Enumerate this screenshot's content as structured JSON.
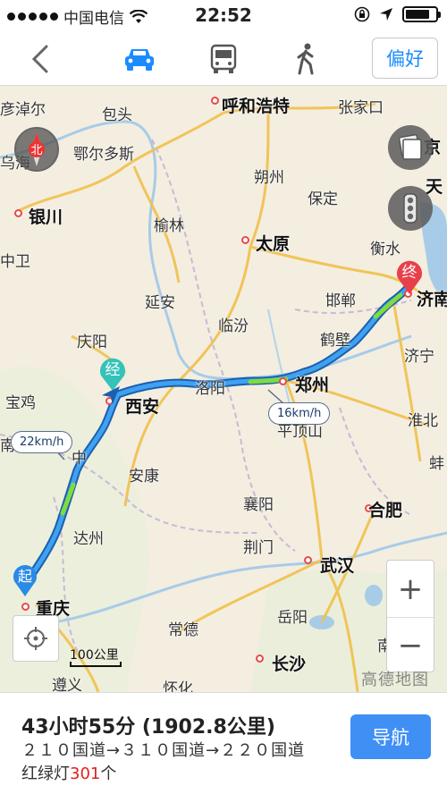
{
  "status_bar": {
    "carrier": "中国电信",
    "time": "22:52",
    "battery_level": 0.8,
    "icons": [
      "signal-dots-icon",
      "wifi-icon",
      "rotation-lock-icon",
      "location-arrow-icon",
      "battery-icon"
    ]
  },
  "nav": {
    "back_icon": "chevron-left-icon",
    "modes": [
      {
        "name": "car-icon",
        "active": true
      },
      {
        "name": "bus-icon",
        "active": false
      },
      {
        "name": "walk-icon",
        "active": false
      }
    ],
    "preference_label": "偏好"
  },
  "map": {
    "cities": [
      {
        "id": "yandanger",
        "label": "彦淖尔",
        "major": false
      },
      {
        "id": "baotou",
        "label": "包头",
        "major": false
      },
      {
        "id": "huhehaote",
        "label": "呼和浩特",
        "major": true
      },
      {
        "id": "zhangjiakou",
        "label": "张家口",
        "major": false
      },
      {
        "id": "wuhai",
        "label": "乌海",
        "major": false
      },
      {
        "id": "eerduosi",
        "label": "鄂尔多斯",
        "major": false
      },
      {
        "id": "shuozhou",
        "label": "朔州",
        "major": false
      },
      {
        "id": "baoding",
        "label": "保定",
        "major": false
      },
      {
        "id": "tian",
        "label": "天",
        "major": false
      },
      {
        "id": "jing",
        "label": "京",
        "major": false
      },
      {
        "id": "yinchuan",
        "label": "银川",
        "major": true
      },
      {
        "id": "yulin",
        "label": "榆林",
        "major": false
      },
      {
        "id": "taiyuan",
        "label": "太原",
        "major": true
      },
      {
        "id": "hengshui",
        "label": "衡水",
        "major": false
      },
      {
        "id": "zhongwei",
        "label": "中卫",
        "major": false
      },
      {
        "id": "yanan",
        "label": "延安",
        "major": false
      },
      {
        "id": "handan",
        "label": "邯郸",
        "major": false
      },
      {
        "id": "jinan",
        "label": "济南",
        "major": true
      },
      {
        "id": "qingyang",
        "label": "庆阳",
        "major": false
      },
      {
        "id": "linfen",
        "label": "临汾",
        "major": false
      },
      {
        "id": "hebi",
        "label": "鹤壁",
        "major": false
      },
      {
        "id": "jining",
        "label": "济宁",
        "major": false
      },
      {
        "id": "baoji",
        "label": "宝鸡",
        "major": false
      },
      {
        "id": "xian",
        "label": "西安",
        "major": true
      },
      {
        "id": "luoyang",
        "label": "洛阳",
        "major": false
      },
      {
        "id": "zhengzhou",
        "label": "郑州",
        "major": true
      },
      {
        "id": "huaibei",
        "label": "淮北",
        "major": false
      },
      {
        "id": "nan",
        "label": "南",
        "major": false
      },
      {
        "id": "zhong",
        "label": "中",
        "major": false
      },
      {
        "id": "ankang",
        "label": "安康",
        "major": false
      },
      {
        "id": "pingdingshan",
        "label": "平顶山",
        "major": false
      },
      {
        "id": "bang",
        "label": "蚌",
        "major": false
      },
      {
        "id": "xiangyang",
        "label": "襄阳",
        "major": false
      },
      {
        "id": "hefei",
        "label": "合肥",
        "major": true
      },
      {
        "id": "dazhou",
        "label": "达州",
        "major": false
      },
      {
        "id": "jingmen",
        "label": "荆门",
        "major": false
      },
      {
        "id": "wuhan",
        "label": "武汉",
        "major": true
      },
      {
        "id": "chongqing",
        "label": "重庆",
        "major": true
      },
      {
        "id": "changde",
        "label": "常德",
        "major": false
      },
      {
        "id": "yueyang",
        "label": "岳阳",
        "major": false
      },
      {
        "id": "nanchang",
        "label": "南",
        "major": false
      },
      {
        "id": "changsha",
        "label": "长沙",
        "major": true
      },
      {
        "id": "zunyi",
        "label": "遵义",
        "major": false
      },
      {
        "id": "huaihua",
        "label": "怀化",
        "major": false
      }
    ],
    "speed_tags": [
      {
        "id": "speed-22",
        "label": "22km/h"
      },
      {
        "id": "speed-16",
        "label": "16km/h"
      }
    ],
    "markers": {
      "start": "起",
      "via": "经",
      "end": "终"
    },
    "compass_label": "北",
    "zoom_in": "+",
    "zoom_out": "−",
    "scale_label": "100公里",
    "watermark": "高德地图",
    "route_color": "#2a8ae6"
  },
  "route_info": {
    "time_distance": "43小时55分 (1902.8公里)",
    "roads": "２１０国道→３１０国道→２２０国道",
    "lights_prefix": "红绿灯",
    "lights_count": "301",
    "lights_suffix": "个",
    "navigate_label": "导航"
  }
}
